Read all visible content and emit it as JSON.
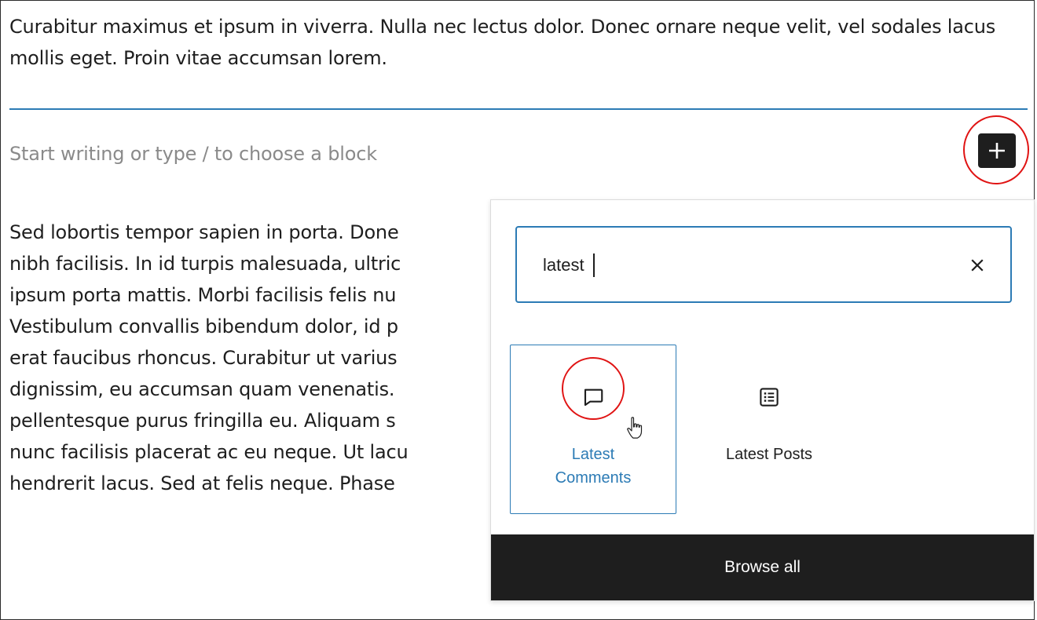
{
  "editor": {
    "paragraph_top": "Curabitur maximus et ipsum in viverra. Nulla nec lectus dolor. Donec ornare neque velit, vel sodales lacus mollis eget. Proin vitae accumsan lorem.",
    "placeholder": "Start writing or type / to choose a block",
    "paragraph_bottom_lines": [
      "Sed lobortis tempor sapien in porta. Done",
      "nibh facilisis. In id turpis malesuada, ultric",
      "ipsum porta mattis. Morbi facilisis felis nu",
      "Vestibulum convallis bibendum dolor, id p",
      "erat faucibus rhoncus. Curabitur ut varius",
      "dignissim, eu accumsan quam venenatis.",
      "pellentesque purus fringilla eu. Aliquam s",
      "nunc facilisis placerat ac eu neque. Ut lacu",
      "hendrerit lacus. Sed at felis neque. Phase"
    ],
    "add_block_icon": "plus-icon"
  },
  "inserter": {
    "search_value": "latest",
    "clear_icon": "close-icon",
    "results": [
      {
        "label_line1": "Latest",
        "label_line2": "Comments",
        "icon": "comment-icon",
        "selected": true
      },
      {
        "label": "Latest Posts",
        "icon": "post-list-icon",
        "selected": false
      }
    ],
    "browse_all_label": "Browse all"
  },
  "colors": {
    "accent": "#2c7bb5",
    "annotation_ring": "#e01313",
    "dark": "#1e1e1e"
  }
}
